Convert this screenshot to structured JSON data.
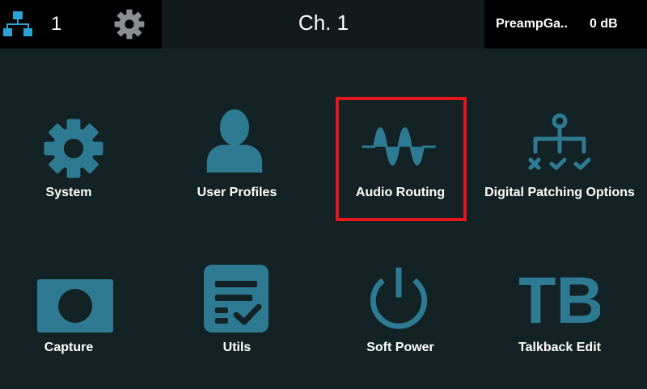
{
  "header": {
    "network_icon": "network-tree-icon",
    "channel_count": "1",
    "settings_icon": "gear-icon",
    "channel_title": "Ch. 1",
    "param_name": "PreampGa..",
    "param_value": "0 dB"
  },
  "menu": {
    "items": [
      {
        "label": "System",
        "icon": "gear-icon"
      },
      {
        "label": "User Profiles",
        "icon": "user-icon"
      },
      {
        "label": "Audio Routing",
        "icon": "waveform-icon",
        "selected": true
      },
      {
        "label": "Digital Patching Options",
        "icon": "patching-tree-icon"
      },
      {
        "label": "Capture",
        "icon": "camera-capture-icon"
      },
      {
        "label": "Utils",
        "icon": "checklist-icon"
      },
      {
        "label": "Soft Power",
        "icon": "power-icon"
      },
      {
        "label": "Talkback Edit",
        "icon": "tb-icon",
        "icon_text": "TB"
      }
    ]
  },
  "colors": {
    "background": "#132224",
    "icon": "#2e7a93",
    "selection": "#e5161d",
    "network_icon": "#2aa3d6"
  }
}
